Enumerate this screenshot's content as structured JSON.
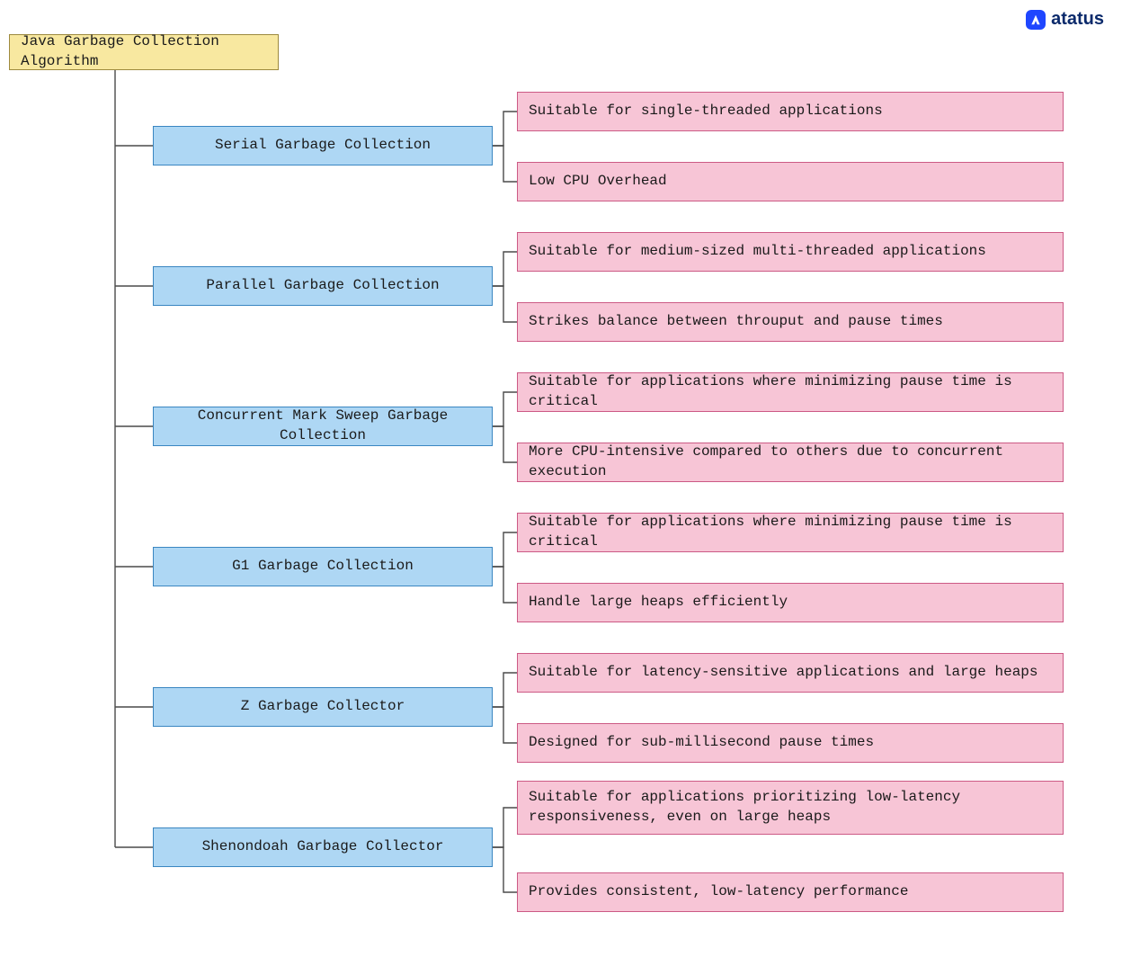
{
  "logo_text": "atatus",
  "root": {
    "label": "Java Garbage Collection Algorithm"
  },
  "branches": [
    {
      "label": "Serial Garbage Collection",
      "leaves": [
        "Suitable for single-threaded applications",
        "Low CPU Overhead"
      ]
    },
    {
      "label": "Parallel Garbage Collection",
      "leaves": [
        "Suitable for medium-sized multi-threaded applications",
        "Strikes balance between throuput and pause times"
      ]
    },
    {
      "label": "Concurrent Mark Sweep Garbage Collection",
      "leaves": [
        "Suitable for applications where minimizing pause time is critical",
        "More CPU-intensive compared to others due to concurrent execution"
      ]
    },
    {
      "label": "G1 Garbage Collection",
      "leaves": [
        "Suitable for applications where minimizing pause time is critical",
        "Handle large heaps efficiently"
      ]
    },
    {
      "label": "Z Garbage Collector",
      "leaves": [
        "Suitable for latency-sensitive applications and large heaps",
        "Designed for sub-millisecond pause times"
      ]
    },
    {
      "label": "Shenondoah Garbage Collector",
      "leaves": [
        "Suitable for applications prioritizing low-latency responsiveness, even on large heaps",
        "Provides consistent, low-latency performance"
      ]
    }
  ]
}
